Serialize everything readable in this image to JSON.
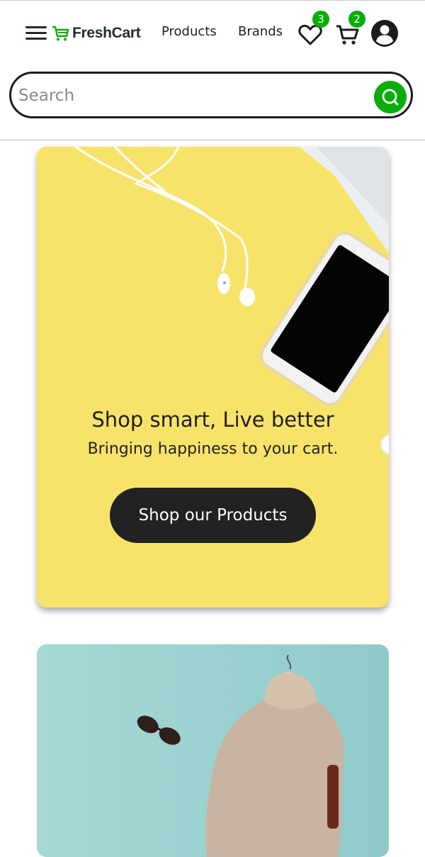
{
  "header": {
    "brand": {
      "name": "FreshCart",
      "logo_icon": "cart-icon"
    },
    "menu_icon": "hamburger-icon",
    "nav": [
      {
        "label": "Products"
      },
      {
        "label": "Brands"
      }
    ],
    "wishlist": {
      "icon": "heart-icon",
      "count": "3"
    },
    "cart": {
      "icon": "cart-icon",
      "count": "2"
    },
    "account": {
      "icon": "user-icon"
    },
    "accent_color": "#0aad0a"
  },
  "search": {
    "placeholder": "Search",
    "value": "",
    "icon": "search-icon"
  },
  "hero": {
    "headline": "Shop smart, Live better",
    "subline": "Bringing happiness to your cart.",
    "cta_label": "Shop our Products",
    "background_color": "#f8e36a"
  },
  "promo2": {
    "background_color": "#9fd3d3"
  }
}
